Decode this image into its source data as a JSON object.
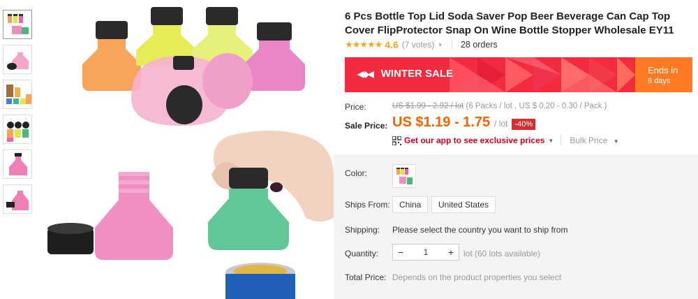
{
  "product": {
    "title": "6 Pcs Bottle Top Lid Soda Saver Pop Beer Beverage Can Cap Top Cover FlipProtector Snap On Wine Bottle Stopper Wholesale EY11",
    "stars": "★★★★★",
    "rating": "4.6",
    "votes": "(7 votes)",
    "orders": "28 orders"
  },
  "banner": {
    "logo": "◀◆◀",
    "label": "WINTER SALE",
    "ends_label": "Ends in",
    "ends_value": "6 days",
    "colors": {
      "main": "#f22b3f",
      "side": "#ff7a22"
    }
  },
  "pricing": {
    "price_label": "Price:",
    "old_price": "US $1.99 - 2.92 / lot",
    "old_price_note": "(6 Packs / lot , US $ 0.20 - 0.30 / Pack )",
    "sale_label": "Sale Price:",
    "sale_price": "US $1.19 - 1.75",
    "sale_unit": "/ lot",
    "discount": "-40%",
    "app_link": "Get our app to see exclusive prices",
    "bulk_price": "Bulk Price",
    "accent": "#f56400"
  },
  "properties": {
    "color_label": "Color:",
    "ships_from_label": "Ships From:",
    "ships_from_options": [
      "China",
      "United States"
    ],
    "shipping_label": "Shipping:",
    "shipping_text": "Please select the country you want to ship from",
    "quantity_label": "Quantity:",
    "quantity_minus": "−",
    "quantity_value": "1",
    "quantity_plus": "+",
    "quantity_available": "lot (60 lots available)",
    "total_label": "Total Price:",
    "total_text": "Depends on the product properties you select"
  },
  "icons": {
    "rating_chevron": "▾",
    "dropdown": "▼"
  }
}
